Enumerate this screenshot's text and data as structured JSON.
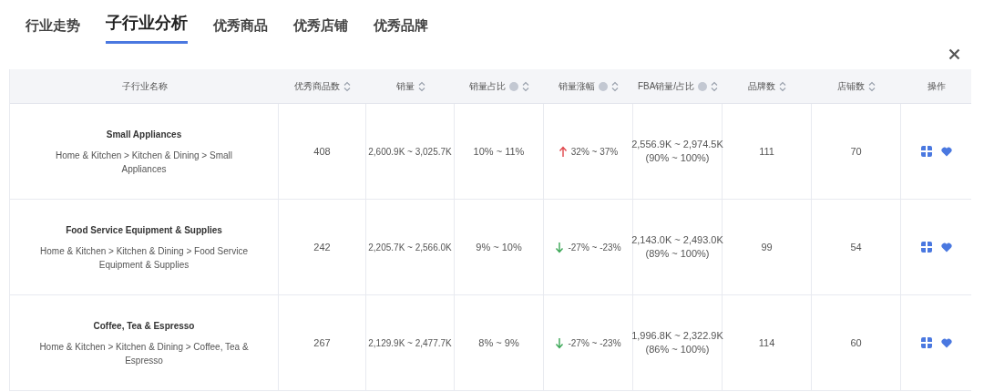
{
  "tabs": [
    {
      "label": "行业走势",
      "selected": false
    },
    {
      "label": "子行业分析",
      "selected": true
    },
    {
      "label": "优秀商品",
      "selected": false
    },
    {
      "label": "优秀店铺",
      "selected": false
    },
    {
      "label": "优秀品牌",
      "selected": false
    }
  ],
  "table": {
    "columns": [
      {
        "label": "子行业名称",
        "sortable": false,
        "help": false
      },
      {
        "label": "优秀商品数",
        "sortable": true,
        "help": false
      },
      {
        "label": "销量",
        "sortable": true,
        "help": false
      },
      {
        "label": "销量占比",
        "sortable": true,
        "help": true
      },
      {
        "label": "销量涨幅",
        "sortable": true,
        "help": true
      },
      {
        "label": "FBA销量/占比",
        "sortable": true,
        "help": true
      },
      {
        "label": "品牌数",
        "sortable": true,
        "help": false
      },
      {
        "label": "店铺数",
        "sortable": true,
        "help": false
      },
      {
        "label": "操作",
        "sortable": false,
        "help": false
      }
    ],
    "rows": [
      {
        "name": "Small Appliances",
        "path": "Home & Kitchen > Kitchen & Dining > Small Appliances",
        "products": "408",
        "sales": "2,600.9K ~ 3,025.7K",
        "share": "10% ~ 11%",
        "kind": "up",
        "growth": "32% ~ 37%",
        "fba": "2,556.9K ~ 2,974.5K",
        "fba_share": "(90% ~ 100%)",
        "brands": "111",
        "stores": "70"
      },
      {
        "name": "Food Service Equipment & Supplies",
        "path": "Home & Kitchen > Kitchen & Dining > Food Service Equipment & Supplies",
        "products": "242",
        "sales": "2,205.7K ~ 2,566.0K",
        "share": "9% ~ 10%",
        "kind": "down",
        "growth": "-27% ~ -23%",
        "fba": "2,143.0K ~ 2,493.0K",
        "fba_share": "(89% ~ 100%)",
        "brands": "99",
        "stores": "54"
      },
      {
        "name": "Coffee, Tea & Espresso",
        "path": "Home & Kitchen > Kitchen & Dining > Coffee, Tea & Espresso",
        "products": "267",
        "sales": "2,129.9K ~ 2,477.7K",
        "share": "8% ~ 9%",
        "kind": "down",
        "growth": "-27% ~ -23%",
        "fba": "1,996.8K ~ 2,322.9K",
        "fba_share": "(86% ~ 100%)",
        "brands": "114",
        "stores": "60"
      }
    ]
  }
}
